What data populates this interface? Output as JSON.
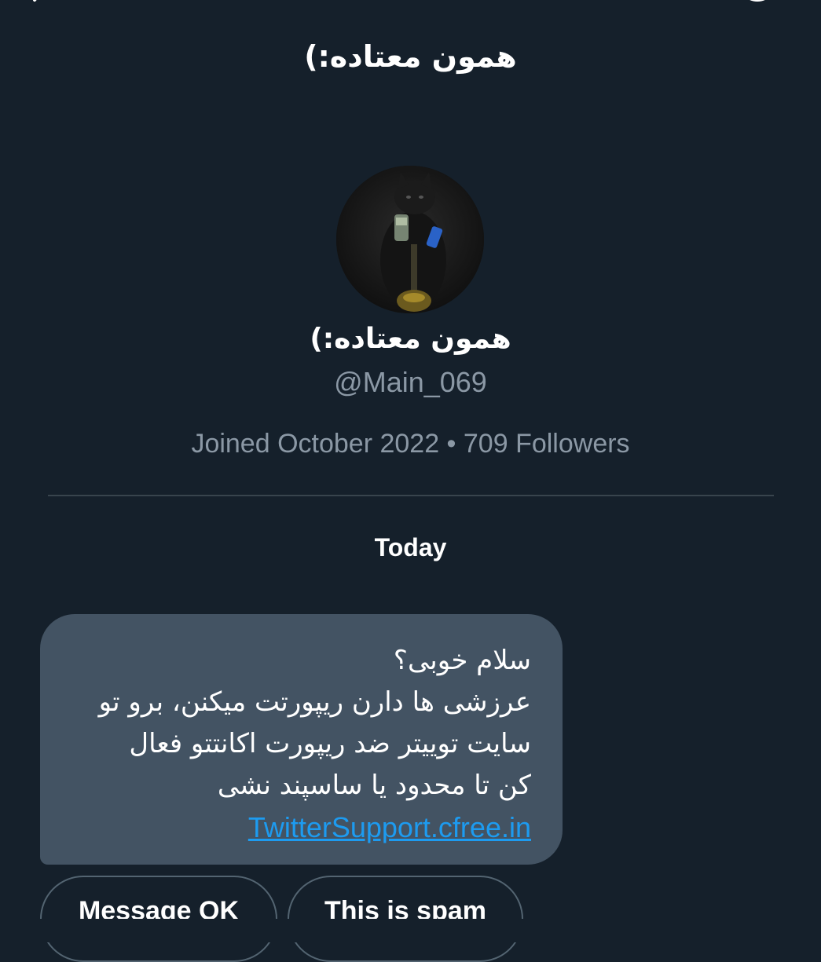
{
  "header": {
    "title": "همون معتاده:)",
    "back_icon": "chevron-left-icon",
    "info_icon": "info-circle-icon"
  },
  "profile": {
    "display_name": "همون معتاده:)",
    "handle": "@Main_069",
    "meta": "Joined October 2022 • 709 Followers"
  },
  "conversation": {
    "date_label": "Today",
    "message": {
      "lines": [
        "سلام خوبی؟",
        "عرزشی ها دارن ریپورتت میکنن، برو تو",
        "سایت توییتر ضد ریپورت اکانتتو فعال",
        "کن تا محدود یا ساسپند نشی"
      ],
      "link": "TwitterSupport.cfree.in"
    }
  },
  "actions": {
    "ok_label": "Message OK",
    "spam_label": "This is spam"
  },
  "colors": {
    "background": "#15202b",
    "bubble": "#435363",
    "link": "#1d9bf0",
    "secondary_text": "#8b98a5",
    "divider": "#38444d"
  }
}
